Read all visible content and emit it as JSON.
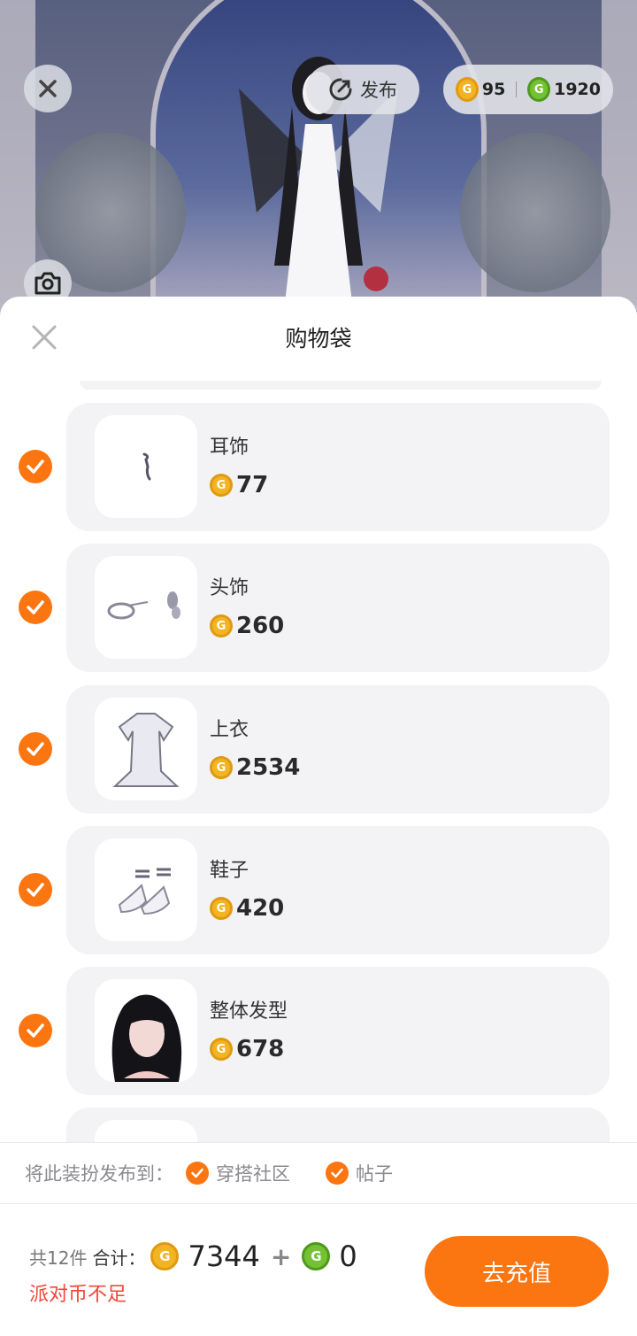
{
  "header": {
    "publish_label": "发布",
    "gold_balance": "95",
    "green_balance": "1920"
  },
  "sheet": {
    "title": "购物袋"
  },
  "items": [
    {
      "name": "耳饰",
      "price": "77"
    },
    {
      "name": "头饰",
      "price": "260"
    },
    {
      "name": "上衣",
      "price": "2534"
    },
    {
      "name": "鞋子",
      "price": "420"
    },
    {
      "name": "整体发型",
      "price": "678"
    }
  ],
  "publish_options": {
    "label": "将此装扮发布到：",
    "options": [
      "穿搭社区",
      "帖子"
    ]
  },
  "footer": {
    "count_label": "共12件",
    "sum_label": "合计：",
    "gold_total": "7344",
    "green_total": "0",
    "warning": "派对币不足",
    "recharge_label": "去充值"
  },
  "colors": {
    "accent": "#fb7510",
    "warning": "#f2453a",
    "gold_coin": "#f3b424",
    "green_coin": "#74c233"
  },
  "icons": {
    "gold_coin_glyph": "G",
    "green_coin_glyph": "G"
  }
}
